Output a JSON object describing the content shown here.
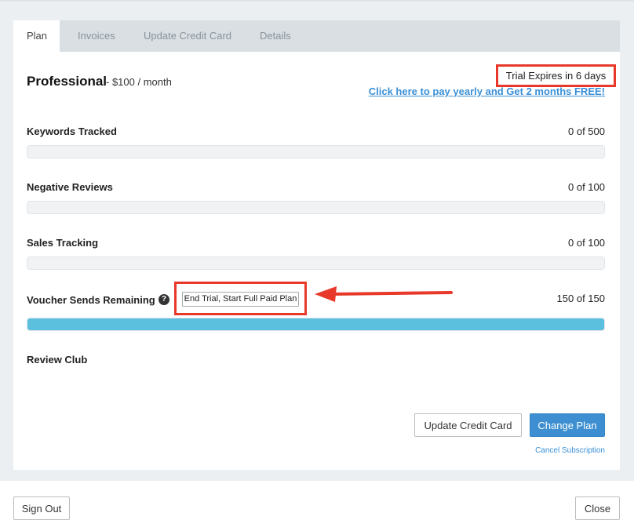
{
  "tabs": [
    "Plan",
    "Invoices",
    "Update Credit Card",
    "Details"
  ],
  "plan": {
    "name": "Professional",
    "price": "- $100 / month",
    "trial_notice": "Trial Expires in 6 days",
    "promo_link": "Click here to pay yearly and Get 2 months FREE!"
  },
  "usage": {
    "keywords": {
      "label": "Keywords Tracked",
      "count": "0 of 500",
      "fill_fraction": 0
    },
    "negative_reviews": {
      "label": "Negative Reviews",
      "count": "0 of 100",
      "fill_fraction": 0
    },
    "sales_tracking": {
      "label": "Sales Tracking",
      "count": "0 of 100",
      "fill_fraction": 0
    },
    "voucher_sends": {
      "label": "Voucher Sends Remaining",
      "count": "150 of 150",
      "fill_fraction": 1
    },
    "review_club": {
      "label": "Review Club"
    }
  },
  "help_icon_glyph": "?",
  "end_trial_button": "End Trial, Start Full Paid Plan",
  "actions": {
    "update_credit_card": "Update Credit Card",
    "change_plan": "Change Plan",
    "cancel_subscription": "Cancel Subscription"
  },
  "footer": {
    "sign_out": "Sign Out",
    "close": "Close"
  },
  "colors": {
    "accent": "#3d8fd1",
    "progress_fill": "#5bc0de",
    "highlight": "#e8382a",
    "link": "#3a8fd6"
  }
}
